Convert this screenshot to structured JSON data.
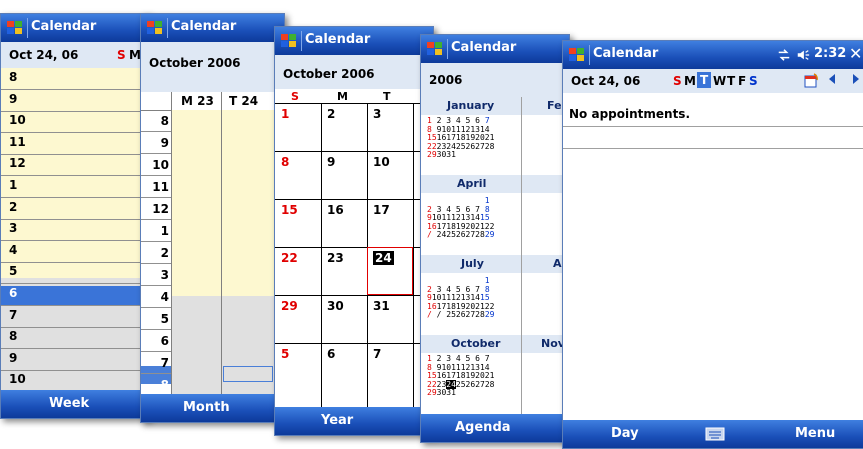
{
  "app_title": "Calendar",
  "week_view": {
    "date": "Oct 24, 06",
    "days_fragment": [
      "S",
      "M"
    ],
    "hours": [
      "8",
      "9",
      "10",
      "11",
      "12",
      "1",
      "2",
      "3",
      "4",
      "5",
      "6",
      "7",
      "8",
      "9",
      "10"
    ],
    "softkey": "Week"
  },
  "month_view": {
    "header": "October 2006",
    "day_cols": [
      "M 23",
      "T 24"
    ],
    "hours": [
      "8",
      "9",
      "10",
      "11",
      "12",
      "1",
      "2",
      "3",
      "4",
      "5",
      "6",
      "7",
      "8"
    ],
    "softkey": "Month"
  },
  "year_month_view": {
    "header": "October 2006",
    "weekdays": [
      "S",
      "M",
      "T"
    ],
    "rows": [
      [
        "1",
        "2",
        "3"
      ],
      [
        "8",
        "9",
        "10"
      ],
      [
        "15",
        "16",
        "17"
      ],
      [
        "22",
        "23",
        "24"
      ],
      [
        "29",
        "30",
        "31"
      ],
      [
        "5",
        "6",
        "7"
      ]
    ],
    "softkey": "Year"
  },
  "year_view": {
    "year": "2006",
    "months": [
      "January",
      "Fe",
      "April",
      "July",
      "A",
      "October",
      "Nov"
    ],
    "softkey": "Agenda"
  },
  "day_view": {
    "date": "Oct 24, 06",
    "week_letters": [
      "S",
      "M",
      "T",
      "W",
      "T",
      "F",
      "S"
    ],
    "clock": "2:32",
    "message": "No appointments.",
    "softkey_left": "Day",
    "softkey_right": "Menu"
  },
  "colors": {
    "titlebar": "#1a4fb8",
    "sunday": "#e00000",
    "saturday": "#0033cc",
    "shaded": "#fdf8d0"
  }
}
